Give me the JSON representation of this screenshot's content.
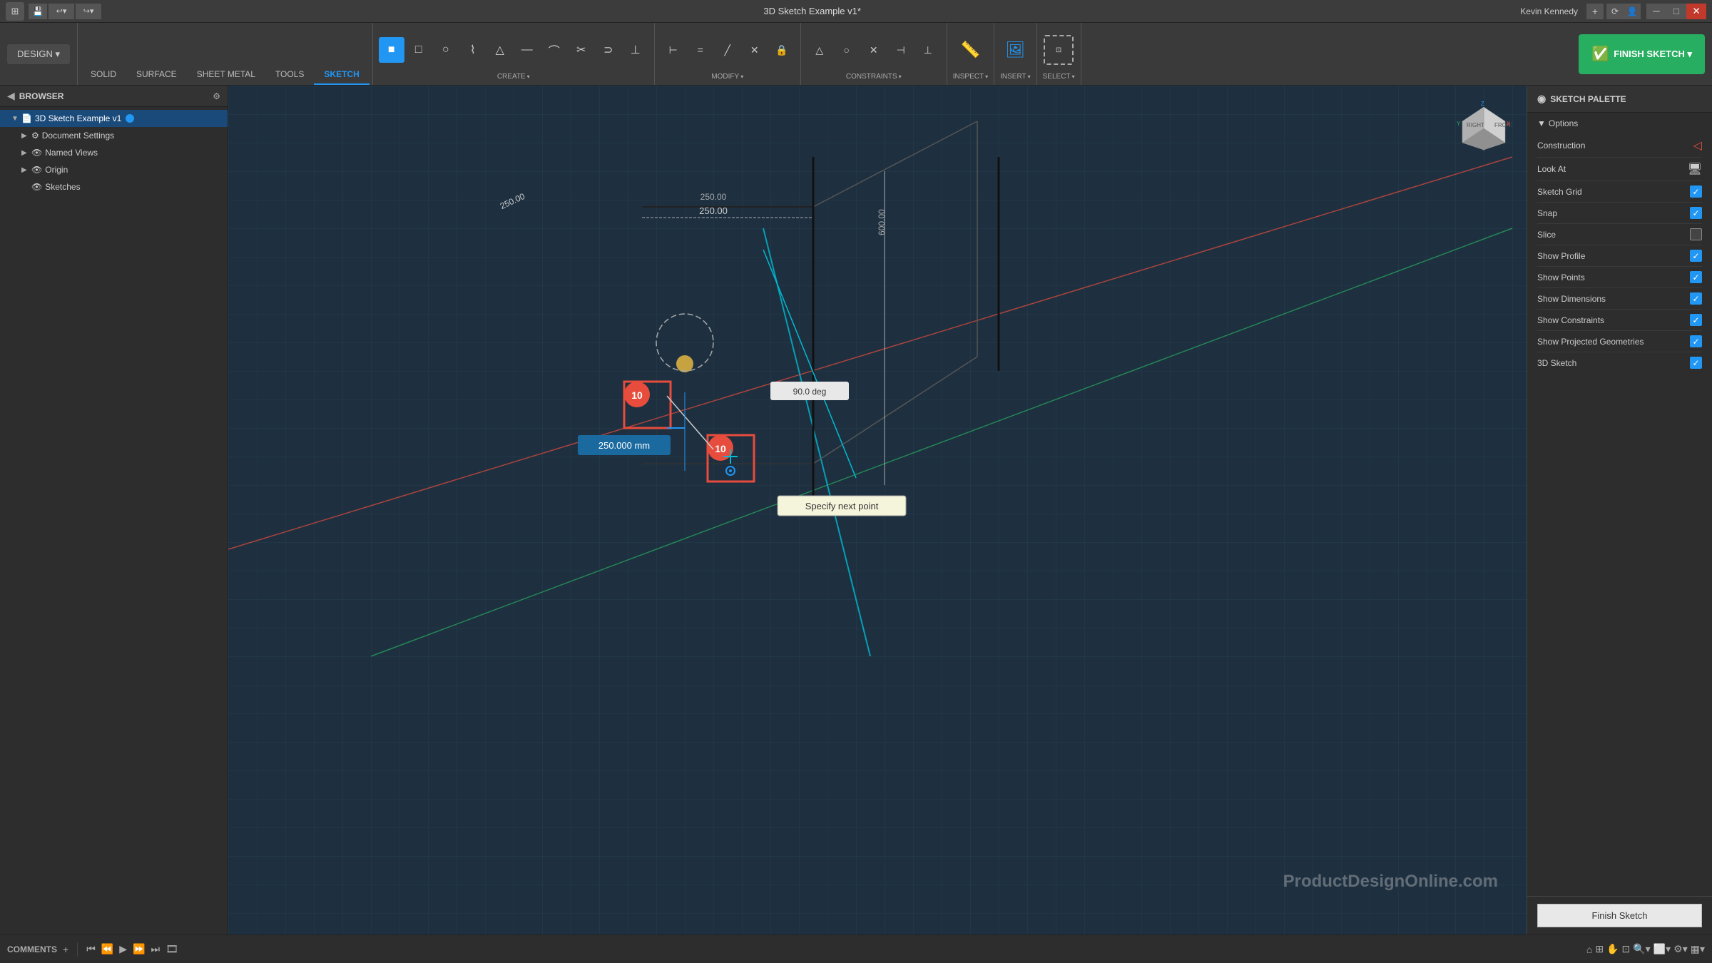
{
  "window": {
    "title": "3D Sketch Example v1*",
    "user": "Kevin Kennedy"
  },
  "toolbar": {
    "tabs": [
      "SOLID",
      "SURFACE",
      "SHEET METAL",
      "TOOLS",
      "SKETCH"
    ],
    "active_tab": "SKETCH",
    "design_label": "DESIGN ▾",
    "sections": [
      {
        "label": "CREATE ▾",
        "tools": [
          "rect-fill",
          "rect-outline",
          "circle",
          "line-path",
          "triangle",
          "horiz-line",
          "arc",
          "cut-tool",
          "slot",
          "point"
        ]
      },
      {
        "label": "MODIFY ▾",
        "tools": [
          "trim",
          "extend",
          "fillet",
          "mirror",
          "scale",
          "offset"
        ]
      },
      {
        "label": "CONSTRAINTS ▾",
        "tools": [
          "lock",
          "triangle-c",
          "circle-c",
          "x-c",
          "bracket-c",
          "constraint-c"
        ]
      },
      {
        "label": "INSPECT ▾",
        "tools": [
          "measure"
        ]
      },
      {
        "label": "INSERT ▾",
        "tools": [
          "insert-img"
        ]
      },
      {
        "label": "SELECT ▾",
        "tools": [
          "select-box"
        ]
      }
    ],
    "finish_sketch_label": "FINISH SKETCH ▾"
  },
  "sidebar": {
    "title": "BROWSER",
    "items": [
      {
        "id": "root",
        "label": "3D Sketch Example v1",
        "indent": 0,
        "has_arrow": true,
        "icon": "📄",
        "active": true
      },
      {
        "id": "doc-settings",
        "label": "Document Settings",
        "indent": 1,
        "has_arrow": true,
        "icon": "⚙️"
      },
      {
        "id": "named-views",
        "label": "Named Views",
        "indent": 1,
        "has_arrow": true,
        "icon": "📁"
      },
      {
        "id": "origin",
        "label": "Origin",
        "indent": 1,
        "has_arrow": true,
        "icon": "📁"
      },
      {
        "id": "sketches",
        "label": "Sketches",
        "indent": 1,
        "has_arrow": false,
        "icon": "📁"
      }
    ]
  },
  "canvas": {
    "tooltip": "Specify next point",
    "dimension_label": "250.000 mm",
    "angle_label": "90.0 deg",
    "snap_numbers": [
      "10",
      "10"
    ]
  },
  "sketch_palette": {
    "header": "SKETCH PALETTE",
    "section_label": "Options",
    "rows": [
      {
        "id": "construction",
        "label": "Construction",
        "control_type": "icon",
        "icon": "◁"
      },
      {
        "id": "look-at",
        "label": "Look At",
        "control_type": "icon",
        "icon": "🖥"
      },
      {
        "id": "sketch-grid",
        "label": "Sketch Grid",
        "control_type": "checkbox",
        "checked": true
      },
      {
        "id": "snap",
        "label": "Snap",
        "control_type": "checkbox",
        "checked": true
      },
      {
        "id": "slice",
        "label": "Slice",
        "control_type": "checkbox",
        "checked": false
      },
      {
        "id": "show-profile",
        "label": "Show Profile",
        "control_type": "checkbox",
        "checked": true
      },
      {
        "id": "show-points",
        "label": "Show Points",
        "control_type": "checkbox",
        "checked": true
      },
      {
        "id": "show-dimensions",
        "label": "Show Dimensions",
        "control_type": "checkbox",
        "checked": true
      },
      {
        "id": "show-constraints",
        "label": "Show Constraints",
        "control_type": "checkbox",
        "checked": true
      },
      {
        "id": "show-projected",
        "label": "Show Projected Geometries",
        "control_type": "checkbox",
        "checked": true
      },
      {
        "id": "3d-sketch",
        "label": "3D Sketch",
        "control_type": "checkbox",
        "checked": true
      }
    ],
    "finish_btn_label": "Finish Sketch"
  },
  "bottombar": {
    "comments_label": "COMMENTS",
    "watermark": "ProductDesignOnline.com"
  }
}
